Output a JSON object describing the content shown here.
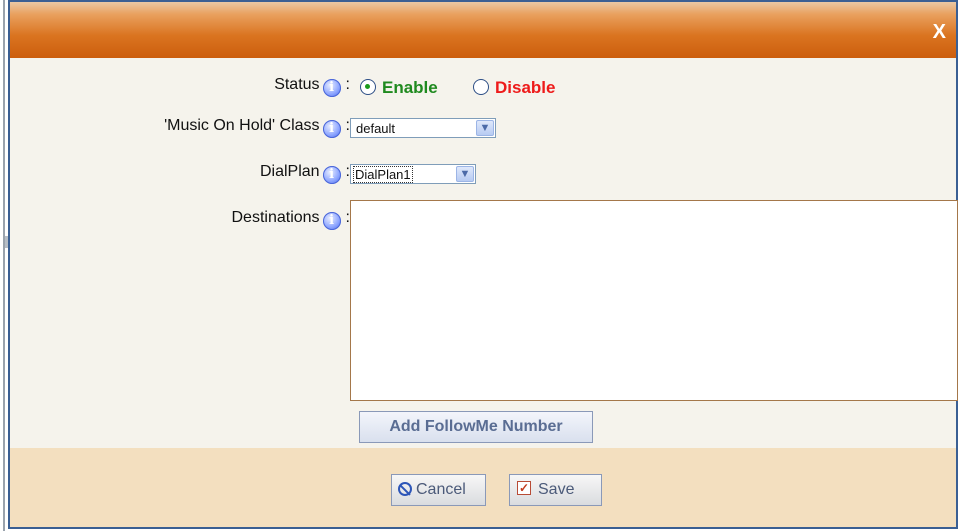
{
  "dialog": {
    "close_label": "X"
  },
  "form": {
    "status": {
      "label": "Status",
      "colon": ":",
      "options": [
        {
          "label": "Enable",
          "checked": true,
          "color": "#1f8a1f"
        },
        {
          "label": "Disable",
          "checked": false,
          "color": "#ee1a1a"
        }
      ]
    },
    "moh_class": {
      "label": "'Music On Hold' Class",
      "colon": ":",
      "value": "default"
    },
    "dialplan": {
      "label": "DialPlan",
      "colon": ":",
      "value": "DialPlan1"
    },
    "destinations": {
      "label": "Destinations",
      "colon": ":",
      "value": ""
    },
    "add_button": "Add FollowMe Number"
  },
  "footer": {
    "cancel_label": "Cancel",
    "save_label": "Save"
  },
  "icons": {
    "info": "info-icon",
    "close": "close-icon",
    "cancel": "cancel-icon",
    "save": "save-checkbox-icon",
    "dropdown": "chevron-down-icon"
  },
  "colors": {
    "titlebar": "#da7420",
    "frame": "#3a5f93",
    "body_bg": "#f5f3ec",
    "footer_bg": "#f3dfbf",
    "info_icon": "#3f5fe6"
  }
}
